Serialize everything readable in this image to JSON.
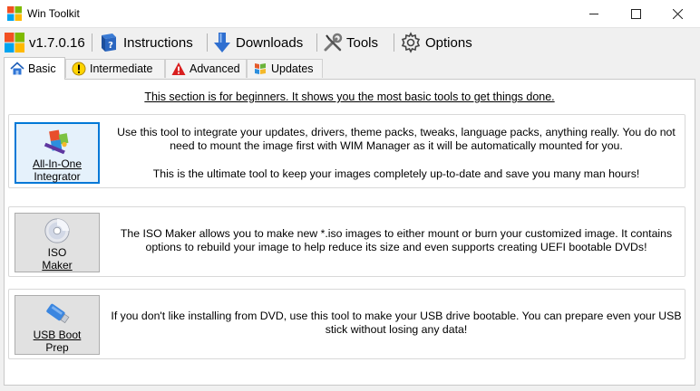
{
  "window": {
    "title": "Win Toolkit"
  },
  "toolbar": {
    "version": "v1.7.0.16",
    "instructions": "Instructions",
    "downloads": "Downloads",
    "tools": "Tools",
    "options": "Options"
  },
  "tabs": [
    {
      "label": "Basic",
      "icon": "house-icon",
      "active": true
    },
    {
      "label": "Intermediate",
      "icon": "warning-icon"
    },
    {
      "label": "Advanced",
      "icon": "alert-icon"
    },
    {
      "label": "Updates",
      "icon": "updates-icon"
    }
  ],
  "intro": "This section is for beginners. It shows you the most basic tools to get things done.",
  "tools": [
    {
      "label_line1": "All-In-One",
      "label_line2": "Integrator",
      "icon": "integrator-icon",
      "desc_line1": "Use this tool to integrate your updates, drivers, theme packs, tweaks, language packs, anything really. You do not",
      "desc_line2": "need to mount the image first with WIM Manager as it will be automatically mounted for you.",
      "desc_line3": "This is the ultimate tool to keep your images completely up-to-date and save you many man hours!"
    },
    {
      "label_line1": "ISO",
      "label_line2": "Maker",
      "icon": "disc-icon",
      "desc_line1": "The ISO Maker allows you to make new *.iso images to either mount or burn your customized image. It contains",
      "desc_line2": "options to rebuild your image to help reduce its size and even supports creating UEFI bootable DVDs!"
    },
    {
      "label_line1": "USB Boot",
      "label_line2": "Prep",
      "icon": "usb-drive-icon",
      "desc_line1": "If you don't like installing from DVD, use this tool to make your USB drive bootable. You can prepare even your USB",
      "desc_line2": "stick without losing any data!"
    }
  ]
}
